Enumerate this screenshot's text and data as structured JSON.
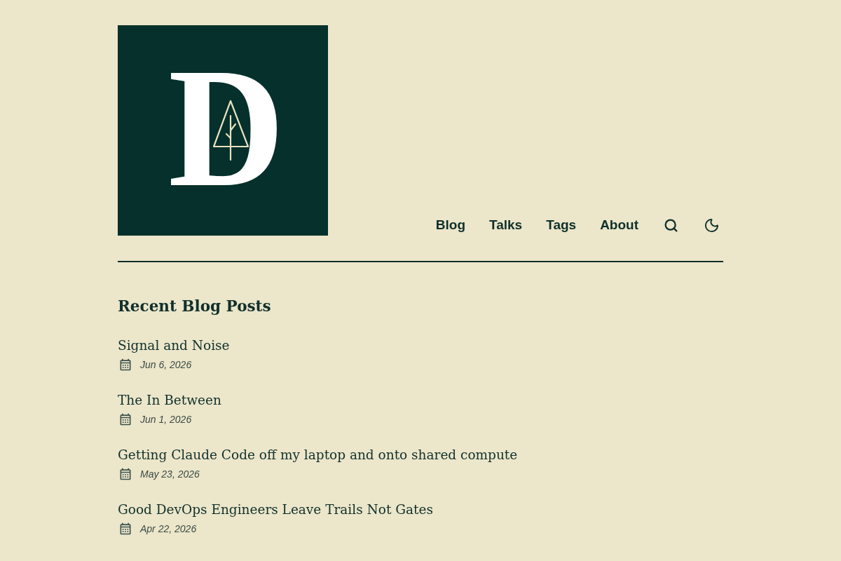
{
  "logo": {
    "letter": "D"
  },
  "nav": {
    "links": [
      {
        "label": "Blog"
      },
      {
        "label": "Talks"
      },
      {
        "label": "Tags"
      },
      {
        "label": "About"
      }
    ]
  },
  "section": {
    "heading": "Recent Blog Posts"
  },
  "posts": [
    {
      "title": "Signal and Noise",
      "date": "Jun 6, 2026"
    },
    {
      "title": "The In Between",
      "date": "Jun 1, 2026"
    },
    {
      "title": "Getting Claude Code off my laptop and onto shared compute",
      "date": "May 23, 2026"
    },
    {
      "title": "Good DevOps Engineers Leave Trails Not Gates",
      "date": "Apr 22, 2026"
    }
  ]
}
